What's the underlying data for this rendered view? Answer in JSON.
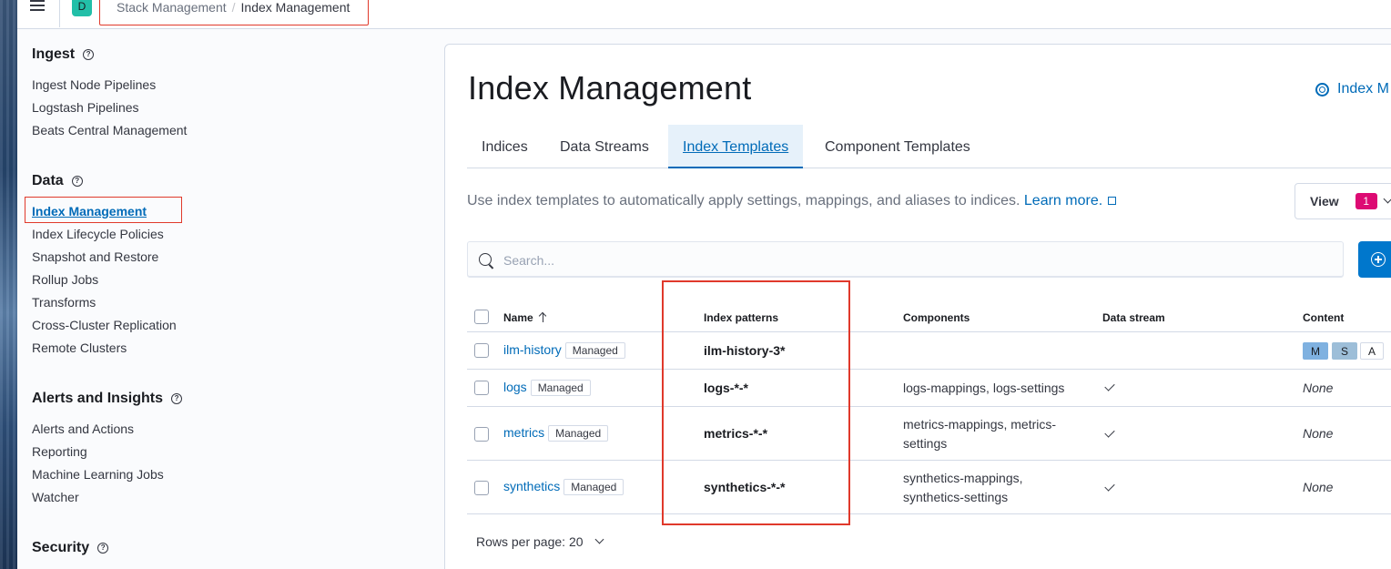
{
  "header": {
    "space_initial": "D",
    "breadcrumbs": {
      "parent": "Stack Management",
      "separator": "/",
      "current": "Index Management"
    }
  },
  "sidebar": {
    "groups": [
      {
        "title": "Ingest",
        "items": [
          "Ingest Node Pipelines",
          "Logstash Pipelines",
          "Beats Central Management"
        ]
      },
      {
        "title": "Data",
        "items": [
          "Index Management",
          "Index Lifecycle Policies",
          "Snapshot and Restore",
          "Rollup Jobs",
          "Transforms",
          "Cross-Cluster Replication",
          "Remote Clusters"
        ]
      },
      {
        "title": "Alerts and Insights",
        "items": [
          "Alerts and Actions",
          "Reporting",
          "Machine Learning Jobs",
          "Watcher"
        ]
      },
      {
        "title": "Security",
        "items": []
      }
    ],
    "help_glyph": "?"
  },
  "main": {
    "title": "Index Management",
    "docs_link": "Index M",
    "tabs": [
      "Indices",
      "Data Streams",
      "Index Templates",
      "Component Templates"
    ],
    "description": "Use index templates to automatically apply settings, mappings, and aliases to indices.",
    "learn_more": "Learn more.",
    "view_button": {
      "label": "View",
      "count": "1"
    },
    "search": {
      "placeholder": "Search..."
    },
    "table": {
      "columns": {
        "name": "Name",
        "patterns": "Index patterns",
        "components": "Components",
        "data_stream": "Data stream",
        "content": "Content"
      },
      "rows": [
        {
          "name": "ilm-history",
          "badge": "Managed",
          "patterns": "ilm-history-3*",
          "components": "",
          "data_stream": false,
          "content": [
            "M",
            "S",
            "A"
          ]
        },
        {
          "name": "logs",
          "badge": "Managed",
          "patterns": "logs-*-*",
          "components": "logs-mappings, logs-settings",
          "data_stream": true,
          "content": "None"
        },
        {
          "name": "metrics",
          "badge": "Managed",
          "patterns": "metrics-*-*",
          "components": "metrics-mappings, metrics-settings",
          "data_stream": true,
          "content": "None"
        },
        {
          "name": "synthetics",
          "badge": "Managed",
          "patterns": "synthetics-*-*",
          "components": "synthetics-mappings, synthetics-settings",
          "data_stream": true,
          "content": "None"
        }
      ]
    },
    "rows_per_page": "Rows per page: 20"
  },
  "colors": {
    "accent": "#006bb8",
    "primary_button": "#0077cc",
    "badge_pink": "#dd0a73",
    "annotation_red": "#e0392b"
  }
}
